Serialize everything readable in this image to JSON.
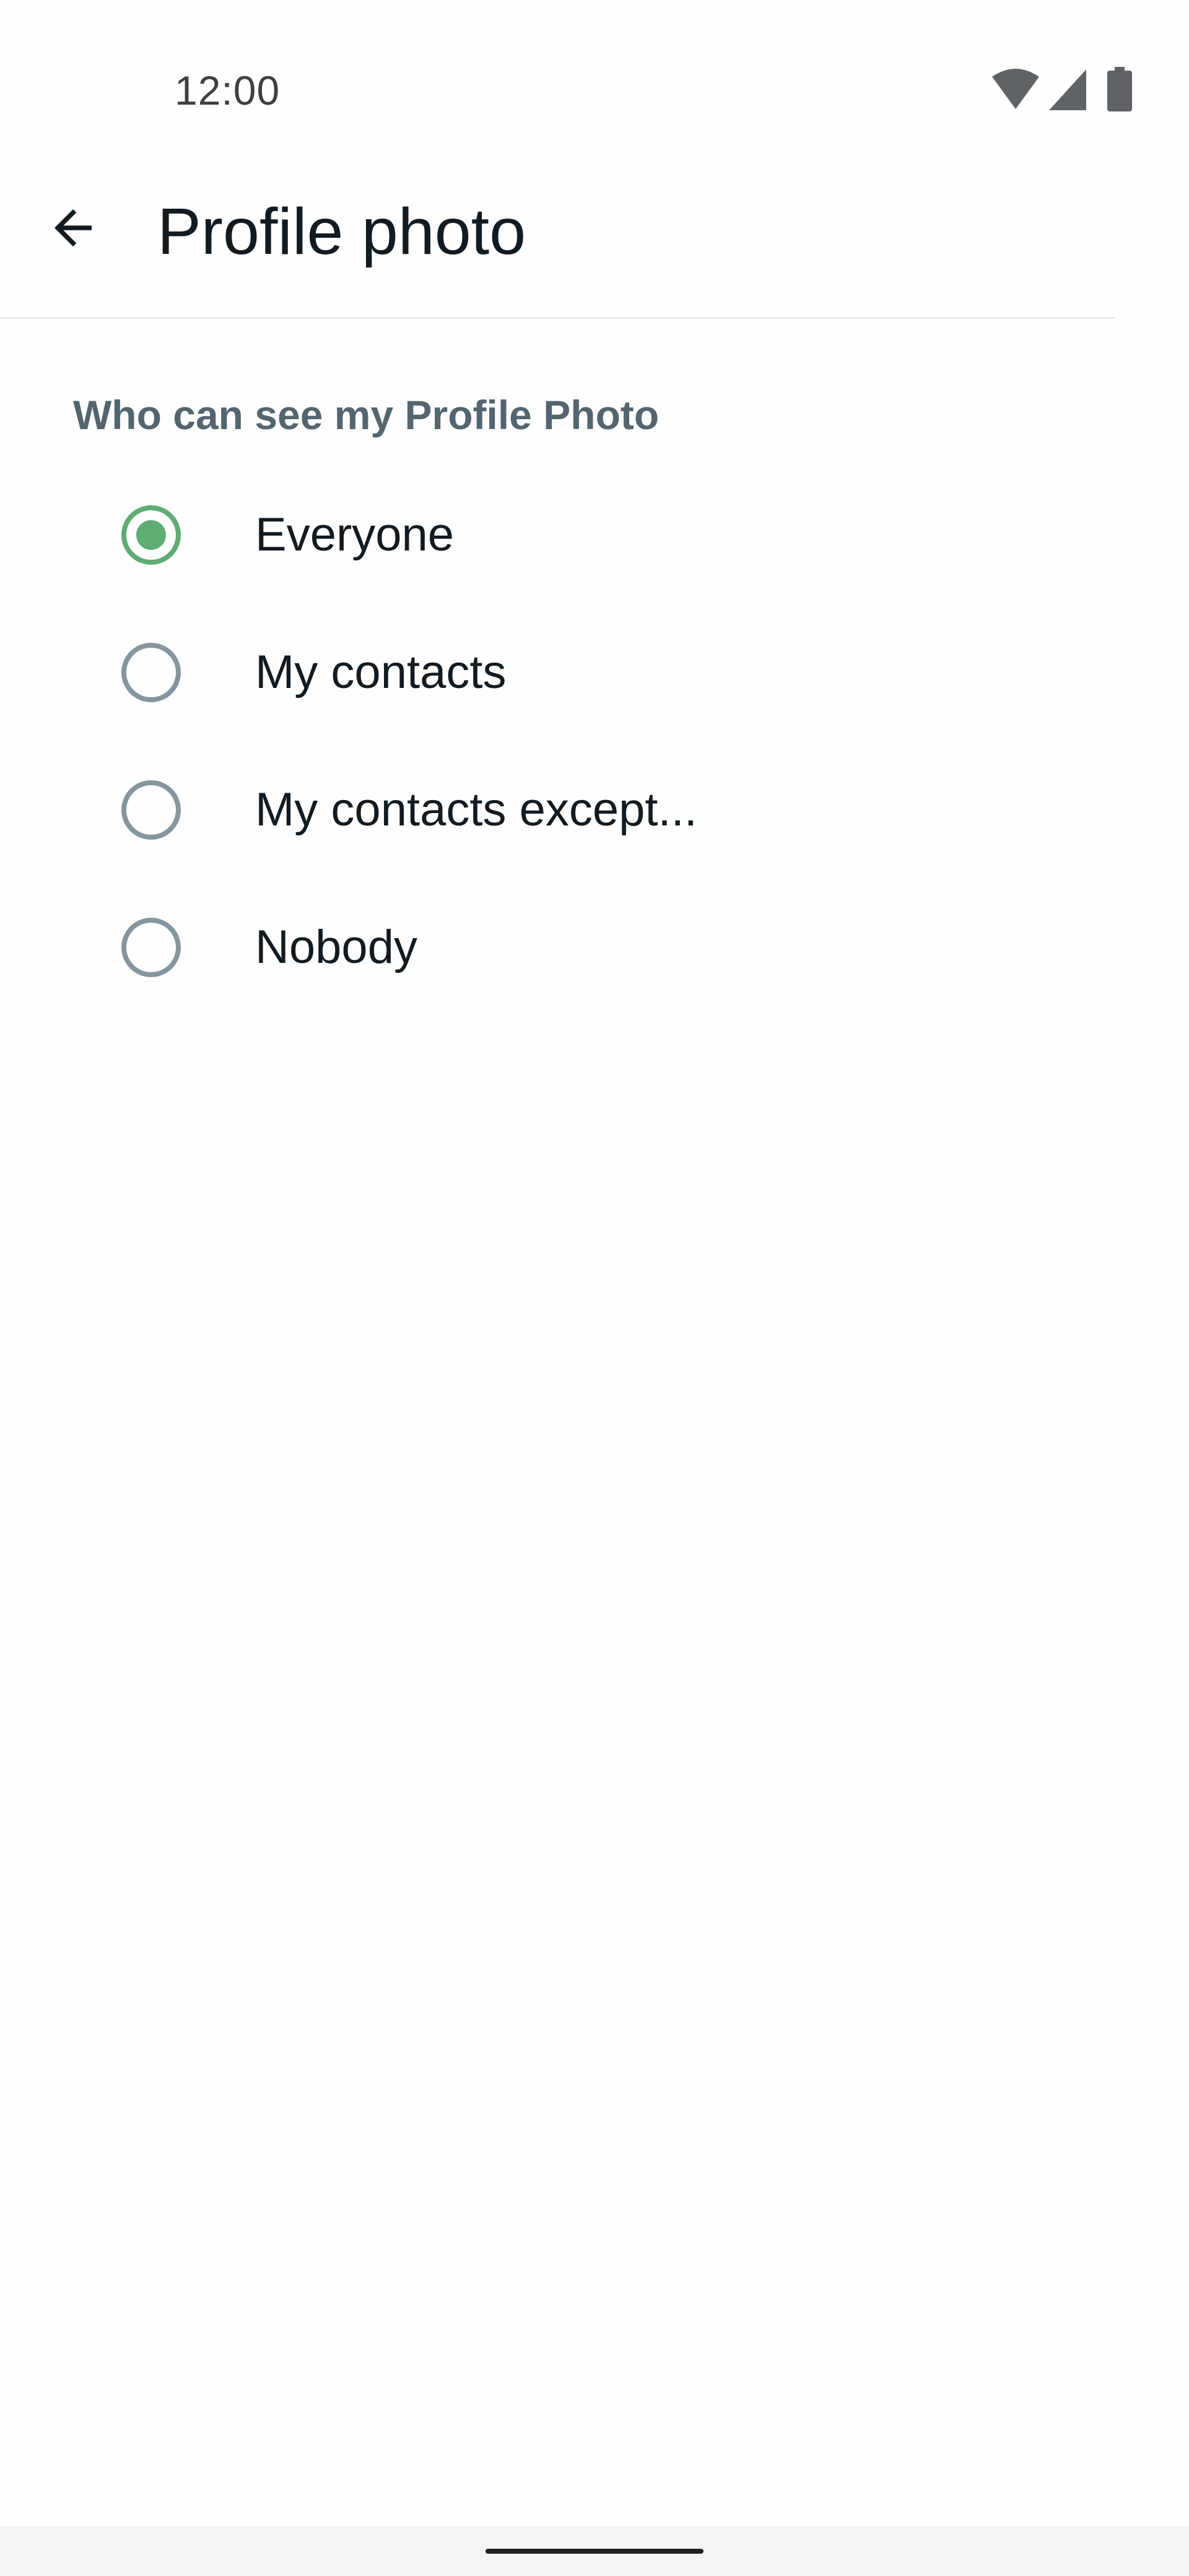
{
  "status_bar": {
    "time": "12:00",
    "icons": [
      "wifi-icon",
      "cell-signal-icon",
      "battery-icon"
    ]
  },
  "app_bar": {
    "back_icon": "arrow-back-icon",
    "title": "Profile photo"
  },
  "section": {
    "header": "Who can see my Profile Photo",
    "options": [
      {
        "label": "Everyone",
        "selected": true
      },
      {
        "label": "My contacts",
        "selected": false
      },
      {
        "label": "My contacts except...",
        "selected": false
      },
      {
        "label": "Nobody",
        "selected": false
      }
    ]
  },
  "colors": {
    "accent": "#5fac75",
    "radio_unchecked": "#8696a0",
    "title_text": "#111b21",
    "section_header": "#54656f"
  }
}
